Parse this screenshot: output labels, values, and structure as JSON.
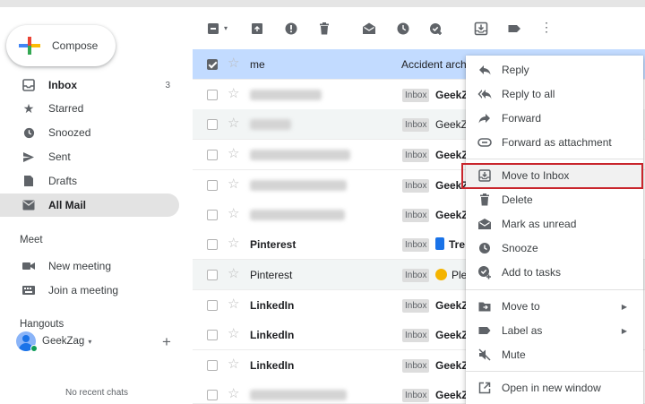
{
  "sidebar": {
    "compose_label": "Compose",
    "items": [
      {
        "label": "Inbox",
        "count": "3",
        "icon": "inbox-icon"
      },
      {
        "label": "Starred",
        "icon": "star-icon"
      },
      {
        "label": "Snoozed",
        "icon": "clock-icon"
      },
      {
        "label": "Sent",
        "icon": "send-icon"
      },
      {
        "label": "Drafts",
        "icon": "draft-icon"
      },
      {
        "label": "All Mail",
        "icon": "mail-icon"
      }
    ],
    "meet": {
      "heading": "Meet",
      "items": [
        {
          "label": "New meeting",
          "icon": "video-icon"
        },
        {
          "label": "Join a meeting",
          "icon": "keyboard-icon"
        }
      ]
    },
    "hangouts": {
      "heading": "Hangouts",
      "user": "GeekZag",
      "empty": "No recent chats"
    }
  },
  "emails": [
    {
      "sender": "me",
      "subject": "Accident arch",
      "selected": true
    },
    {
      "badge": "Inbox",
      "subject": "GeekZ"
    },
    {
      "badge": "Inbox",
      "subject": "GeekZ"
    },
    {
      "badge": "Inbox",
      "subject": "GeekZ"
    },
    {
      "badge": "Inbox",
      "subject": "GeekZ"
    },
    {
      "badge": "Inbox",
      "subject": "GeekZ"
    },
    {
      "sender": "Pinterest",
      "badge": "Inbox",
      "subject": "Tre"
    },
    {
      "sender": "Pinterest",
      "badge": "Inbox",
      "subject": "Ple"
    },
    {
      "sender": "LinkedIn",
      "badge": "Inbox",
      "subject": "GeekZ"
    },
    {
      "sender": "LinkedIn",
      "badge": "Inbox",
      "subject": "GeekZ"
    },
    {
      "sender": "LinkedIn",
      "badge": "Inbox",
      "subject": "GeekZ"
    },
    {
      "badge": "Inbox",
      "subject": "GeekZ"
    }
  ],
  "context_menu": {
    "items": [
      {
        "label": "Reply",
        "icon": "reply-icon"
      },
      {
        "label": "Reply to all",
        "icon": "reply-all-icon"
      },
      {
        "label": "Forward",
        "icon": "forward-icon"
      },
      {
        "label": "Forward as attachment",
        "icon": "attachment-icon"
      },
      {
        "label": "Move to Inbox",
        "icon": "move-to-inbox-icon",
        "highlighted": true
      },
      {
        "label": "Delete",
        "icon": "trash-icon"
      },
      {
        "label": "Mark as unread",
        "icon": "mark-unread-icon"
      },
      {
        "label": "Snooze",
        "icon": "clock-icon"
      },
      {
        "label": "Add to tasks",
        "icon": "add-task-icon"
      },
      {
        "label": "Move to",
        "icon": "folder-icon"
      },
      {
        "label": "Label as",
        "icon": "label-icon"
      },
      {
        "label": "Mute",
        "icon": "mute-icon"
      },
      {
        "label": "Open in new window",
        "icon": "open-new-window-icon"
      }
    ]
  },
  "colors": {
    "selected_row": "#c2dbff",
    "highlight_border": "#c9252c",
    "active_nav": "#e3e3e3"
  }
}
